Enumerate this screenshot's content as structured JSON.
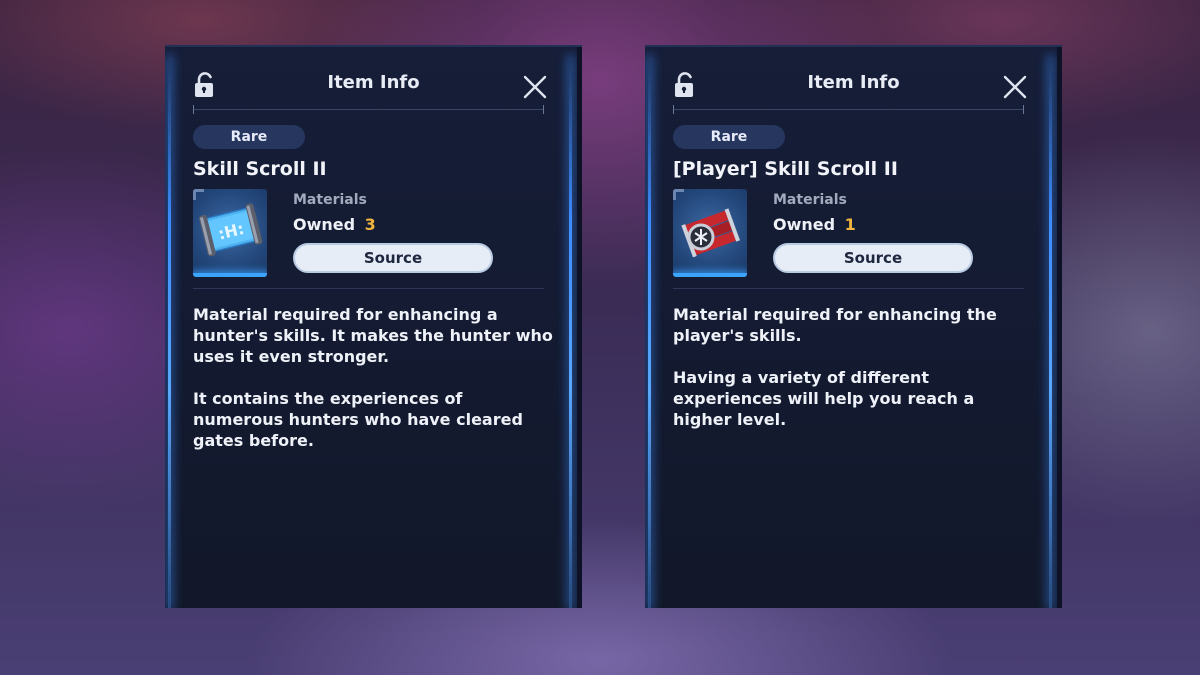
{
  "panels": [
    {
      "header_title": "Item Info",
      "rarity": "Rare",
      "item_name": "Skill Scroll II",
      "category": "Materials",
      "owned_label": "Owned",
      "owned_count": "3",
      "source_label": "Source",
      "description_1": "Material required for enhancing a hunter's skills. It makes the hunter who uses it even stronger.",
      "description_2": "It contains the experiences of numerous hunters who have cleared gates before.",
      "icon": "skill-scroll-icon"
    },
    {
      "header_title": "Item Info",
      "rarity": "Rare",
      "item_name": "[Player] Skill Scroll II",
      "category": "Materials",
      "owned_label": "Owned",
      "owned_count": "1",
      "source_label": "Source",
      "description_1": "Material required for enhancing the player's skills.",
      "description_2": "Having a variety of different experiences will help you reach a higher level.",
      "icon": "player-skill-scroll-icon"
    }
  ],
  "colors": {
    "accent_glow": "#3d8cff",
    "owned_count": "#f1b43c",
    "rarity_pill": "#26365f"
  }
}
